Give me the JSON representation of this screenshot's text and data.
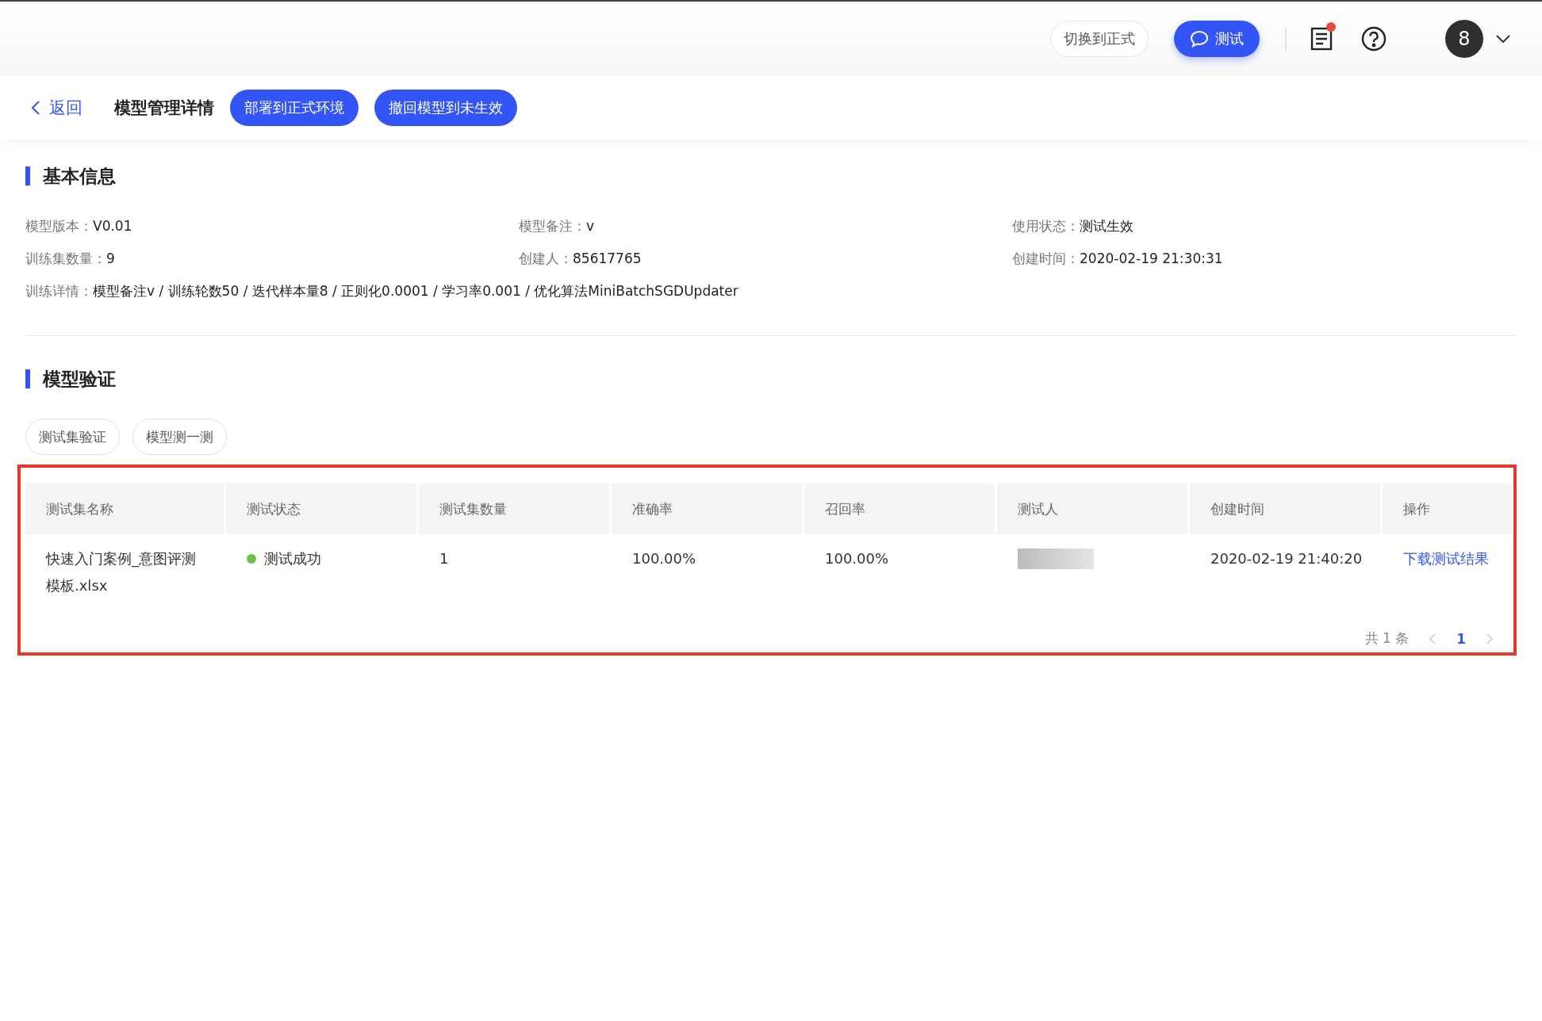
{
  "top_bar": {
    "switch_button": "切换到正式",
    "test_button": "测试",
    "notes_unread": true,
    "avatar": "8"
  },
  "sub_header": {
    "back": "返回",
    "title": "模型管理详情",
    "actions": [
      "部署到正式环境",
      "撤回模型到未生效"
    ]
  },
  "basic_info": {
    "title": "基本信息",
    "fields": [
      {
        "label": "模型版本：",
        "value": "V0.01"
      },
      {
        "label": "模型备注：",
        "value": "v"
      },
      {
        "label": "使用状态：",
        "value": "测试生效"
      },
      {
        "label": "训练集数量：",
        "value": "9"
      },
      {
        "label": "创建人：",
        "value": "85617765"
      },
      {
        "label": "创建时间：",
        "value": "2020-02-19 21:30:31"
      }
    ],
    "detail": {
      "label": "训练详情：",
      "value": "模型备注v / 训练轮数50 / 迭代样本量8 / 正则化0.0001 / 学习率0.001 / 优化算法MiniBatchSGDUpdater"
    }
  },
  "validation": {
    "title": "模型验证",
    "tabs": [
      {
        "label": "测试集验证",
        "selected": false
      },
      {
        "label": "模型测一测",
        "selected": false
      }
    ],
    "table": {
      "highlighted": true,
      "columns": [
        "测试集名称",
        "测试状态",
        "测试集数量",
        "准确率",
        "召回率",
        "测试人",
        "创建时间",
        "操作"
      ],
      "rows": [
        {
          "name": "快速入门案例_意图评测模板.xlsx",
          "status": {
            "kind": "success",
            "text": "测试成功"
          },
          "count": "1",
          "precision": "100.00%",
          "recall": "100.00%",
          "tester_redacted": true,
          "created": "2020-02-19 21:40:20",
          "action": "下载测试结果"
        }
      ]
    },
    "pagination": {
      "total": "共 1 条",
      "pages": [
        {
          "label": "1",
          "selected": true
        }
      ]
    }
  }
}
